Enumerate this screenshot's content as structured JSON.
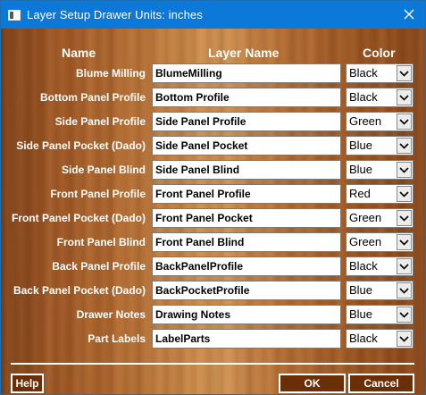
{
  "window": {
    "title": "Layer Setup Drawer Units: inches"
  },
  "headers": {
    "name": "Name",
    "layer_name": "Layer Name",
    "color": "Color"
  },
  "rows": [
    {
      "label": "Blume Milling",
      "layer": "BlumeMilling",
      "color": "Black"
    },
    {
      "label": "Bottom Panel Profile",
      "layer": "Bottom Profile",
      "color": "Black"
    },
    {
      "label": "Side Panel Profile",
      "layer": "Side Panel Profile",
      "color": "Green"
    },
    {
      "label": "Side Panel Pocket (Dado)",
      "layer": "Side Panel Pocket",
      "color": "Blue"
    },
    {
      "label": "Side Panel Blind",
      "layer": "Side Panel Blind",
      "color": "Blue"
    },
    {
      "label": "Front Panel Profile",
      "layer": "Front Panel Profile",
      "color": "Red"
    },
    {
      "label": "Front Panel Pocket (Dado)",
      "layer": "Front Panel Pocket",
      "color": "Green"
    },
    {
      "label": "Front Panel Blind",
      "layer": "Front Panel Blind",
      "color": "Green"
    },
    {
      "label": "Back Panel Profile",
      "layer": "BackPanelProfile",
      "color": "Black"
    },
    {
      "label": "Back Panel Pocket (Dado)",
      "layer": "BackPocketProfile",
      "color": "Blue"
    },
    {
      "label": "Drawer Notes",
      "layer": "Drawing Notes",
      "color": "Blue"
    },
    {
      "label": "Part Labels",
      "layer": "LabelParts",
      "color": "Black"
    }
  ],
  "buttons": {
    "help": "Help",
    "ok": "OK",
    "cancel": "Cancel"
  },
  "icons": {
    "window_icon": "window-icon",
    "close": "close-icon",
    "dropdown": "chevron-down-icon"
  },
  "colors": {
    "titlebar": "#0c78d7",
    "button_bg": "#6b2f08",
    "wood_mid": "#c98a4a"
  }
}
